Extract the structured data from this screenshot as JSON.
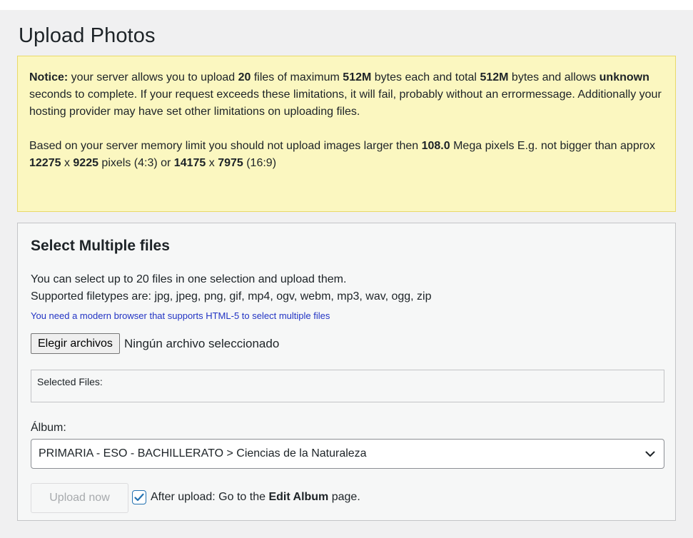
{
  "page": {
    "title": "Upload Photos"
  },
  "notice": {
    "label": "Notice:",
    "t1": " your server allows you to upload ",
    "max_files": "20",
    "t2": " files of maximum ",
    "max_size": "512M",
    "t3": " bytes each and total ",
    "total_size": "512M",
    "t4": " bytes and allows ",
    "seconds": "unknown",
    "t5": " seconds to complete. If your request exceeds these limitations, it will fail, probably without an errormessage. Additionally your hosting provider may have set other limitations on uploading files.",
    "m1": "Based on your server memory limit you should not upload images larger then ",
    "megapixels": "108.0",
    "m2": " Mega pixels E.g. not bigger than approx ",
    "w43": "12275",
    "x1": " x ",
    "h43": "9225",
    "m3": " pixels (4:3) or ",
    "w169": "14175",
    "x2": " x ",
    "h169": "7975",
    "m4": " (16:9)"
  },
  "panel": {
    "title": "Select Multiple files",
    "info_select": "You can select up to 20 files in one selection and upload them.",
    "info_types": "Supported filetypes are: jpg, jpeg, png, gif, mp4, ogv, webm, mp3, wav, ogg, zip",
    "html5_note": "You need a modern browser that supports HTML-5 to select multiple files",
    "file_button": "Elegir archivos",
    "file_status": "Ningún archivo seleccionado",
    "selected_files_label": "Selected Files:",
    "album_label": "Álbum:",
    "album_selected": "PRIMARIA - ESO - BACHILLERATO > Ciencias de la Naturaleza",
    "upload_button": "Upload now",
    "after_upload_pre": "After upload: Go to the ",
    "after_upload_bold": "Edit Album",
    "after_upload_post": " page."
  },
  "icons": {
    "dropdown": "chevron-down-icon",
    "checkbox": "check-icon"
  },
  "colors": {
    "notice_bg": "#fbf7c0",
    "notice_border": "#e9d96a",
    "link": "#2234c4",
    "checkbox_accent": "#2271b1"
  }
}
